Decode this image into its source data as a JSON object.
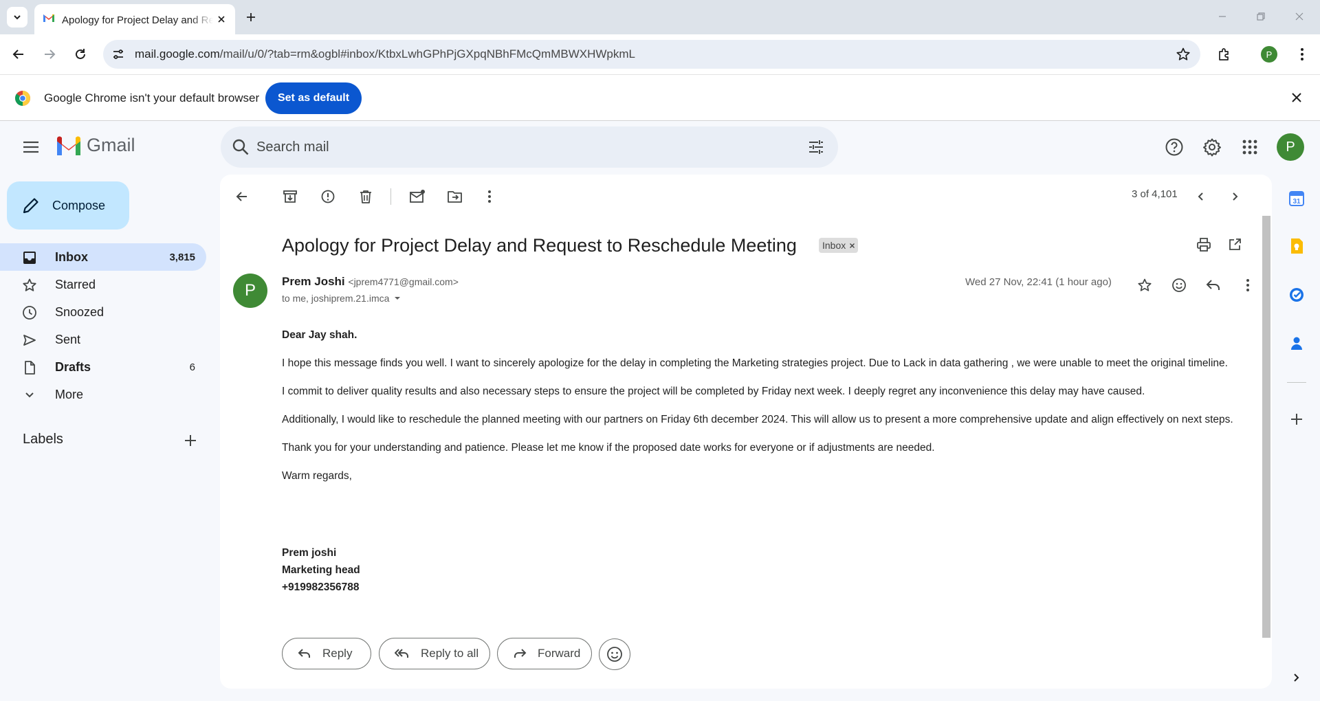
{
  "browser": {
    "tab_title": "Apology for Project Delay and Request to Reschedule Meeting",
    "url_host": "mail.google.com",
    "url_path": "/mail/u/0/?tab=rm&ogbl#inbox/KtbxLwhGPhPjGXpqNBhFMcQmMBWXHWpkmL",
    "profile_initial": "P",
    "infobar_message": "Google Chrome isn't your default browser",
    "infobar_button": "Set as default"
  },
  "gmail": {
    "logo_text": "Gmail",
    "search_placeholder": "Search mail",
    "account_initial": "P",
    "compose_label": "Compose",
    "nav": [
      {
        "label": "Inbox",
        "count": "3,815",
        "icon": "inbox-icon"
      },
      {
        "label": "Starred",
        "count": "",
        "icon": "star-icon"
      },
      {
        "label": "Snoozed",
        "count": "",
        "icon": "clock-icon"
      },
      {
        "label": "Sent",
        "count": "",
        "icon": "send-icon"
      },
      {
        "label": "Drafts",
        "count": "6",
        "icon": "draft-icon"
      },
      {
        "label": "More",
        "count": "",
        "icon": "chevron-down-icon"
      }
    ],
    "labels_title": "Labels"
  },
  "message": {
    "pager": "3 of 4,101",
    "subject": "Apology for Project Delay and Request to Reschedule Meeting",
    "label_chip": "Inbox",
    "sender_initial": "P",
    "sender_name": "Prem Joshi",
    "sender_email": "<jprem4771@gmail.com>",
    "recipients": "to me, joshiprem.21.imca",
    "date": "Wed 27 Nov, 22:41 (1 hour ago)",
    "greeting": "Dear Jay shah.",
    "paragraphs": [
      "I hope this message finds you well. I want to sincerely apologize for the delay in completing the Marketing strategies project. Due to Lack in data gathering , we were unable to meet the original timeline.",
      "I commit to deliver quality results and also necessary steps to ensure the project will be completed by Friday next week. I deeply regret any inconvenience this delay may have caused.",
      "Additionally, I would like to reschedule the planned meeting with our partners on Friday 6th december 2024. This will allow us to present a more comprehensive update and align effectively on next steps.",
      "Thank you for your understanding and patience. Please let me know if the proposed date works for everyone or if adjustments are needed.",
      "Warm regards,"
    ],
    "signature": [
      "Prem joshi",
      "Marketing head",
      "+919982356788"
    ],
    "reply_label": "Reply",
    "reply_all_label": "Reply to all",
    "forward_label": "Forward"
  },
  "side_panel": {
    "calendar_day": "31"
  },
  "colors": {
    "accent": "#0b57d0",
    "compose_bg": "#c2e7ff",
    "nav_active": "#d3e3fd",
    "avatar_green": "#3f8a35"
  }
}
